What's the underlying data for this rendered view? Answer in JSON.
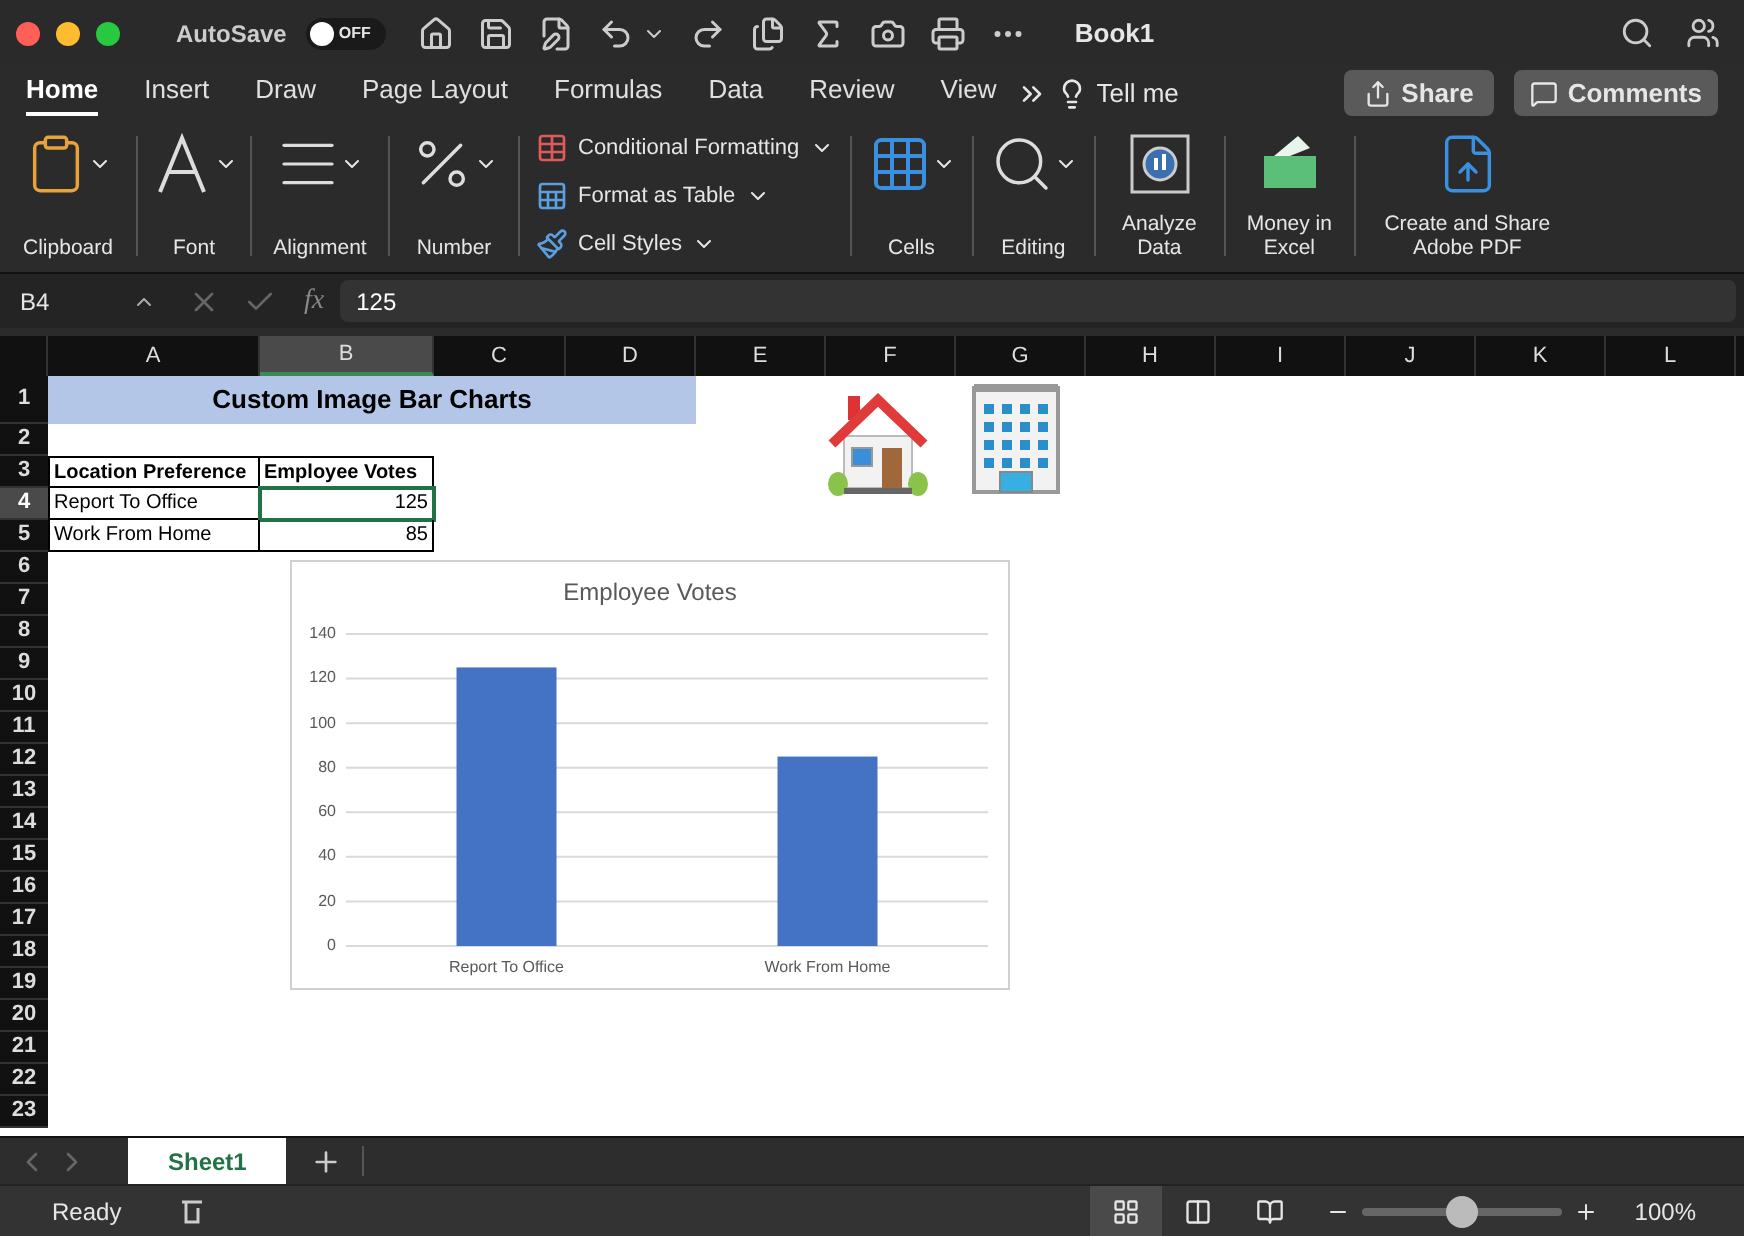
{
  "window": {
    "autosave_label": "AutoSave",
    "autosave": {
      "on": false,
      "label": "OFF"
    },
    "title": "Book1"
  },
  "tabs": [
    {
      "label": "Home",
      "selected": true
    },
    {
      "label": "Insert",
      "selected": false
    },
    {
      "label": "Draw",
      "selected": false
    },
    {
      "label": "Page Layout",
      "selected": false
    },
    {
      "label": "Formulas",
      "selected": false
    },
    {
      "label": "Data",
      "selected": false
    },
    {
      "label": "Review",
      "selected": false
    },
    {
      "label": "View",
      "selected": false
    }
  ],
  "tell_me": "Tell me",
  "share": "Share",
  "comments": "Comments",
  "ribbon": [
    {
      "kind": "big",
      "label": "Clipboard"
    },
    {
      "kind": "big",
      "label": "Font"
    },
    {
      "kind": "big",
      "label": "Alignment"
    },
    {
      "kind": "big",
      "label": "Number"
    },
    {
      "kind": "stack",
      "items": [
        {
          "label": "Conditional Formatting"
        },
        {
          "label": "Format as Table"
        },
        {
          "label": "Cell Styles"
        }
      ]
    },
    {
      "kind": "big",
      "label": "Cells"
    },
    {
      "kind": "big",
      "label": "Editing"
    },
    {
      "kind": "big",
      "label": "Analyze Data"
    },
    {
      "kind": "big",
      "label": "Money in Excel"
    },
    {
      "kind": "big",
      "label": "Create and Share Adobe PDF"
    }
  ],
  "formula_bar": {
    "name_box": "B4",
    "function_label": "fx",
    "formula": "125"
  },
  "sheet": {
    "columns": [
      {
        "label": "A",
        "selected": false
      },
      {
        "label": "B",
        "selected": true
      },
      {
        "label": "C",
        "selected": false
      },
      {
        "label": "D",
        "selected": false
      },
      {
        "label": "E",
        "selected": false
      },
      {
        "label": "F",
        "selected": false
      },
      {
        "label": "G",
        "selected": false
      },
      {
        "label": "H",
        "selected": false
      },
      {
        "label": "I",
        "selected": false
      },
      {
        "label": "J",
        "selected": false
      },
      {
        "label": "K",
        "selected": false
      },
      {
        "label": "L",
        "selected": false
      }
    ],
    "rows": [
      {
        "label": "1",
        "selected": false,
        "cells": [
          {
            "kind": "title",
            "text": "Custom Image Bar Charts"
          }
        ]
      },
      {
        "label": "2",
        "selected": false,
        "cells": []
      },
      {
        "label": "3",
        "selected": false,
        "cells": [
          {
            "kind": "header",
            "text": "Location Preference",
            "selected": false
          },
          {
            "kind": "header",
            "text": "Employee Votes",
            "selected": false
          }
        ]
      },
      {
        "label": "4",
        "selected": true,
        "cells": [
          {
            "kind": "text",
            "text": "Report To Office",
            "selected": false
          },
          {
            "kind": "number",
            "text": "125",
            "selected": true
          }
        ]
      },
      {
        "label": "5",
        "selected": false,
        "cells": [
          {
            "kind": "text",
            "text": "Work From Home",
            "selected": false
          },
          {
            "kind": "number",
            "text": "85",
            "selected": false
          }
        ]
      },
      {
        "label": "6",
        "selected": false,
        "cells": []
      },
      {
        "label": "7",
        "selected": false,
        "cells": []
      },
      {
        "label": "8",
        "selected": false,
        "cells": []
      },
      {
        "label": "9",
        "selected": false,
        "cells": []
      },
      {
        "label": "10",
        "selected": false,
        "cells": []
      },
      {
        "label": "11",
        "selected": false,
        "cells": []
      },
      {
        "label": "12",
        "selected": false,
        "cells": []
      },
      {
        "label": "13",
        "selected": false,
        "cells": []
      },
      {
        "label": "14",
        "selected": false,
        "cells": []
      },
      {
        "label": "15",
        "selected": false,
        "cells": []
      },
      {
        "label": "16",
        "selected": false,
        "cells": []
      },
      {
        "label": "17",
        "selected": false,
        "cells": []
      },
      {
        "label": "18",
        "selected": false,
        "cells": []
      },
      {
        "label": "19",
        "selected": false,
        "cells": []
      },
      {
        "label": "20",
        "selected": false,
        "cells": []
      },
      {
        "label": "21",
        "selected": false,
        "cells": []
      },
      {
        "label": "22",
        "selected": false,
        "cells": []
      },
      {
        "label": "23",
        "selected": false,
        "cells": []
      }
    ],
    "chart": {
      "chart_data": {
        "type": "bar",
        "title": "Employee Votes",
        "categories": [
          "Report To Office",
          "Work From Home"
        ],
        "values": [
          125,
          85
        ],
        "ylim": [
          0,
          140
        ],
        "yticks": [
          0,
          20,
          40,
          60,
          80,
          100,
          120,
          140
        ],
        "grid": true
      }
    }
  },
  "sheet_tabs": [
    {
      "label": "Sheet1",
      "selected": true
    }
  ],
  "status_bar": {
    "status": "Ready",
    "views": [
      {
        "selected": true
      },
      {
        "selected": false
      },
      {
        "selected": false
      }
    ],
    "zoom": {
      "level": 0.5
    },
    "zoom_label": "100%"
  }
}
